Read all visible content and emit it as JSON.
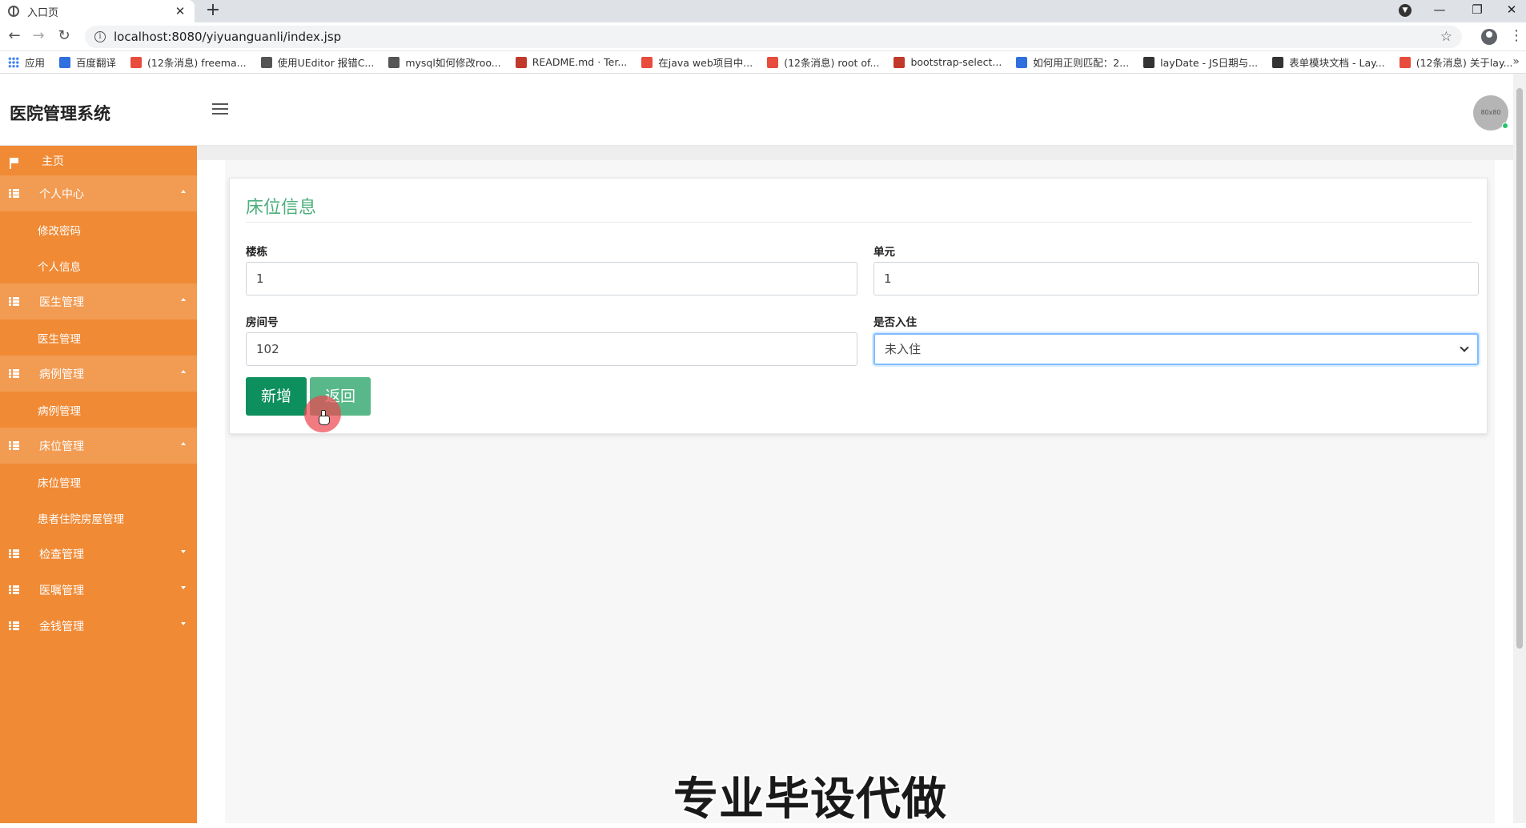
{
  "browser": {
    "tab_title": "入口页",
    "tab_close": "✕",
    "new_tab": "+",
    "url": "localhost:8080/yiyuanguanli/index.jsp",
    "bookmarks": [
      {
        "label": "应用",
        "icon_color": "#4285f4"
      },
      {
        "label": "百度翻译",
        "icon_color": "#2f6fde"
      },
      {
        "label": "(12条消息) freema...",
        "icon_color": "#e74c3c"
      },
      {
        "label": "使用UEditor 报错C...",
        "icon_color": "#555555"
      },
      {
        "label": "mysql如何修改roo...",
        "icon_color": "#555555"
      },
      {
        "label": "README.md · Ter...",
        "icon_color": "#c0392b"
      },
      {
        "label": "在java web项目中...",
        "icon_color": "#e74c3c"
      },
      {
        "label": "(12条消息) root of...",
        "icon_color": "#e74c3c"
      },
      {
        "label": "bootstrap-select...",
        "icon_color": "#c0392b"
      },
      {
        "label": "如何用正则匹配：2...",
        "icon_color": "#2f6fde"
      },
      {
        "label": "layDate - JS日期与...",
        "icon_color": "#333333"
      },
      {
        "label": "表单模块文档 - Lay...",
        "icon_color": "#333333"
      },
      {
        "label": "(12条消息) 关于lay...",
        "icon_color": "#e74c3c"
      }
    ]
  },
  "header": {
    "title": "医院管理系统",
    "avatar_text": "80x80"
  },
  "sidebar": {
    "items": [
      {
        "label": "主页",
        "kind": "top",
        "icon": "flag-icon"
      },
      {
        "label": "个人中心",
        "kind": "parent",
        "icon": "grid-icon",
        "expanded": true
      },
      {
        "label": "修改密码",
        "kind": "sub"
      },
      {
        "label": "个人信息",
        "kind": "sub"
      },
      {
        "label": "医生管理",
        "kind": "parent",
        "icon": "grid-icon",
        "expanded": true
      },
      {
        "label": "医生管理",
        "kind": "sub"
      },
      {
        "label": "病例管理",
        "kind": "parent",
        "icon": "grid-icon",
        "expanded": true
      },
      {
        "label": "病例管理",
        "kind": "sub"
      },
      {
        "label": "床位管理",
        "kind": "parent",
        "icon": "grid-icon",
        "expanded": true
      },
      {
        "label": "床位管理",
        "kind": "sub"
      },
      {
        "label": "患者住院房屋管理",
        "kind": "sub"
      },
      {
        "label": "检查管理",
        "kind": "collapsed",
        "icon": "grid-icon",
        "expanded": false
      },
      {
        "label": "医嘱管理",
        "kind": "collapsed",
        "icon": "grid-icon",
        "expanded": false
      },
      {
        "label": "金钱管理",
        "kind": "collapsed",
        "icon": "grid-icon",
        "expanded": false
      }
    ]
  },
  "form": {
    "title": "床位信息",
    "building_label": "楼栋",
    "building_value": "1",
    "unit_label": "单元",
    "unit_value": "1",
    "room_label": "房间号",
    "room_value": "102",
    "occupied_label": "是否入住",
    "occupied_value": "未入住",
    "add_button": "新增",
    "back_button": "返回"
  },
  "watermark": "专业毕设代做",
  "colors": {
    "sidebar": "#f08a35",
    "accent_green": "#0e8f5e",
    "title_green": "#4caf7d"
  }
}
